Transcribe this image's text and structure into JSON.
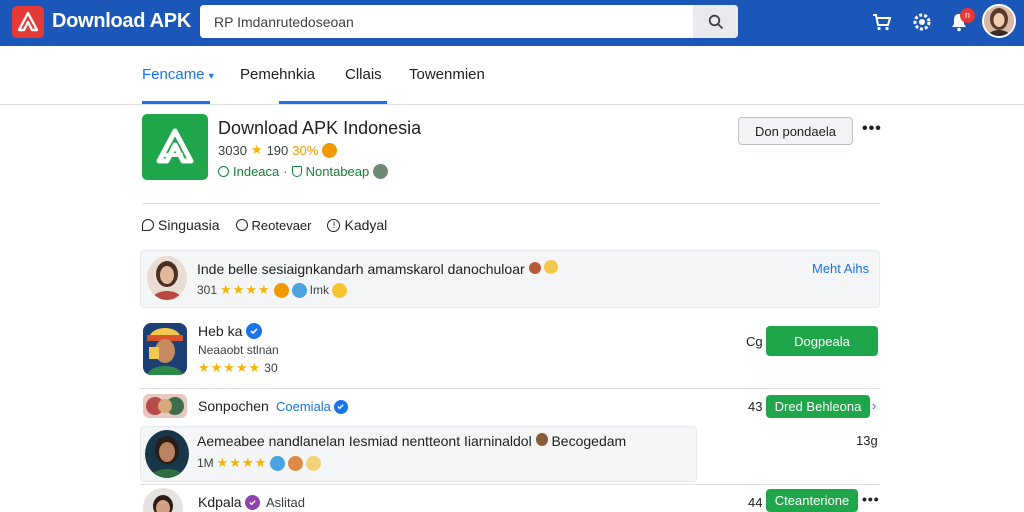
{
  "header": {
    "brand": "Download APK",
    "search_value": "RP Imdanrutedoseoan",
    "notification_count": "n",
    "colors": {
      "bar": "#1a57b8",
      "logo": "#e53935",
      "accent": "#1a73e8",
      "green": "#1fa64a"
    }
  },
  "tabs": [
    {
      "label": "Fencame"
    },
    {
      "label": "Pemehnkia"
    },
    {
      "label": "Cllais"
    },
    {
      "label": "Towenmien"
    }
  ],
  "app": {
    "title": "Download APK Indonesia",
    "meta_a": "3030",
    "meta_b": "190",
    "meta_c": "30%",
    "sub_a": "Indeaca",
    "sub_b": "Nontabeap",
    "download_label": "Don pondaela"
  },
  "filters": [
    {
      "label": "Singuasia",
      "icon": "chat-icon"
    },
    {
      "label": "Reotevaer",
      "icon": "clock-icon"
    },
    {
      "label": "Kadyal",
      "icon": "info-icon"
    }
  ],
  "reviews": [
    {
      "title": "Inde belle sesiaignkandarh amamskarol danochuloar",
      "meta": "301",
      "extra": "Imk",
      "link": "Meht Aihs"
    },
    {
      "title": "Heb ka",
      "subtitle": "Neaaobt stlnan",
      "rating_count": "30",
      "count": "Cg",
      "button": "Dogpeala"
    },
    {
      "title": "Sonpochen",
      "verified_name": "Coemiala",
      "count": "43",
      "button": "Dred Behleona"
    },
    {
      "title": "Aemeabee nandlanelan Iesmiad nentteont Iiarninaldol",
      "title_extra": "Becogedam",
      "meta": "1M",
      "count": "13g"
    },
    {
      "title": "Kdpala",
      "subtitle": "Aslitad",
      "count": "44",
      "button": "Cteanterione"
    }
  ]
}
